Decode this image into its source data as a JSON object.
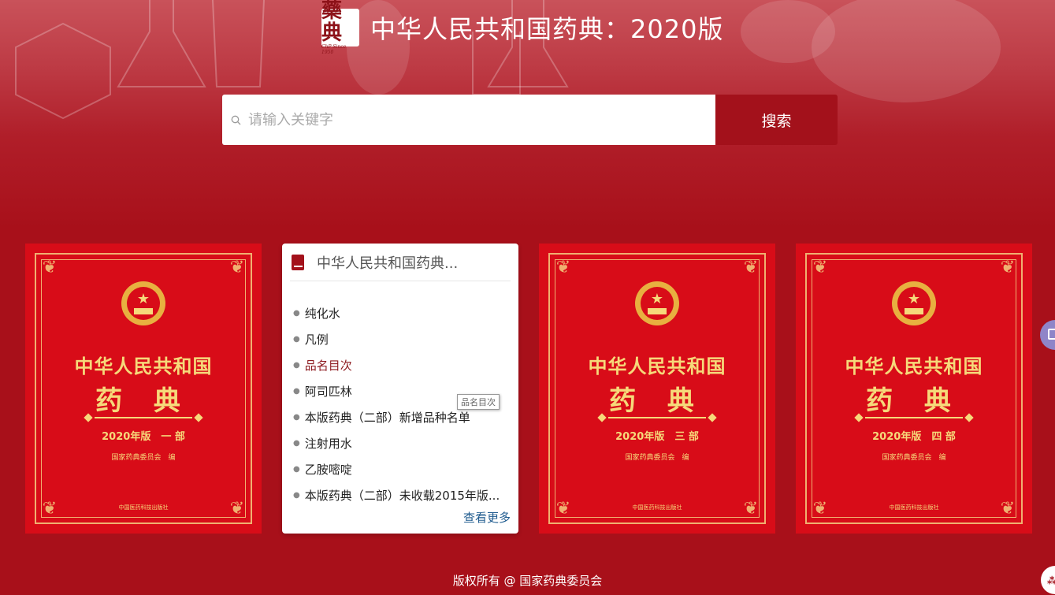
{
  "header": {
    "logo_seal": "藥典",
    "logo_since": "ChP Since 1950",
    "site_title": "中华人民共和国药典：2020版"
  },
  "search": {
    "placeholder": "请输入关键字",
    "value": "",
    "button_label": "搜索"
  },
  "books": [
    {
      "title": "中华人民共和国",
      "big": "药 典",
      "edition": "2020年版　一 部",
      "editor": "国家药典委员会　编",
      "publisher": "中国医药科技出版社"
    },
    {
      "title": "中华人民共和国",
      "big": "药 典",
      "edition": "2020年版　三 部",
      "editor": "国家药典委员会　编",
      "publisher": "中国医药科技出版社"
    },
    {
      "title": "中华人民共和国",
      "big": "药 典",
      "edition": "2020年版　四 部",
      "editor": "国家药典委员会　编",
      "publisher": "中国医药科技出版社"
    }
  ],
  "card": {
    "title": "中华人民共和国药典...",
    "items": [
      "纯化水",
      "凡例",
      "品名目次",
      "阿司匹林",
      "本版药典（二部）新增品种名单",
      "注射用水",
      "乙胺嘧啶",
      "本版药典（二部）未收载2015年版..."
    ],
    "active_index": 2,
    "more_label": "查看更多"
  },
  "tooltip": "品名目次",
  "footer": "版权所有 @ 国家药典委员会",
  "colors": {
    "brand": "#a3111b",
    "book_red": "#d80c18",
    "gold": "#f6d97a",
    "link": "#1f5b8f"
  }
}
